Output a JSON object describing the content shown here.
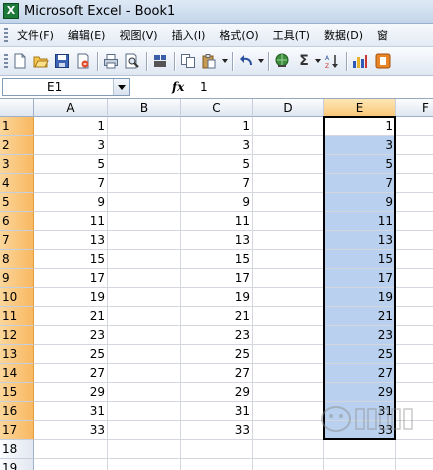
{
  "window": {
    "title": "Microsoft Excel - Book1"
  },
  "menu": [
    "文件(F)",
    "编辑(E)",
    "视图(V)",
    "插入(I)",
    "格式(O)",
    "工具(T)",
    "数据(D)",
    "窗"
  ],
  "toolbar": {
    "icons": [
      "new-icon",
      "open-icon",
      "save-icon",
      "permission-icon",
      "print-icon",
      "print-preview-icon",
      "spelling-icon",
      "copy-icon",
      "paste-icon",
      "undo-icon",
      "hyperlink-icon",
      "autosum-icon",
      "sort-ascending-icon",
      "chart-wizard-icon",
      "help-icon"
    ],
    "autosum_label": "Σ"
  },
  "formula_bar": {
    "name_box": "E1",
    "fx_label": "fx",
    "formula": "1"
  },
  "sheet": {
    "columns": [
      "A",
      "B",
      "C",
      "D",
      "E",
      "F"
    ],
    "selected_column": "E",
    "active_cell": "E1",
    "selection": "E1:E17",
    "rows": [
      {
        "n": "1",
        "A": "1",
        "C": "1",
        "E": "1"
      },
      {
        "n": "2",
        "A": "3",
        "C": "3",
        "E": "3"
      },
      {
        "n": "3",
        "A": "5",
        "C": "5",
        "E": "5"
      },
      {
        "n": "4",
        "A": "7",
        "C": "7",
        "E": "7"
      },
      {
        "n": "5",
        "A": "9",
        "C": "9",
        "E": "9"
      },
      {
        "n": "6",
        "A": "11",
        "C": "11",
        "E": "11"
      },
      {
        "n": "7",
        "A": "13",
        "C": "13",
        "E": "13"
      },
      {
        "n": "8",
        "A": "15",
        "C": "15",
        "E": "15"
      },
      {
        "n": "9",
        "A": "17",
        "C": "17",
        "E": "17"
      },
      {
        "n": "10",
        "A": "19",
        "C": "19",
        "E": "19"
      },
      {
        "n": "11",
        "A": "21",
        "C": "21",
        "E": "21"
      },
      {
        "n": "12",
        "A": "23",
        "C": "23",
        "E": "23"
      },
      {
        "n": "13",
        "A": "25",
        "C": "25",
        "E": "25"
      },
      {
        "n": "14",
        "A": "27",
        "C": "27",
        "E": "27"
      },
      {
        "n": "15",
        "A": "29",
        "C": "29",
        "E": "29"
      },
      {
        "n": "16",
        "A": "31",
        "C": "31",
        "E": "31"
      },
      {
        "n": "17",
        "A": "33",
        "C": "33",
        "E": "33"
      },
      {
        "n": "18"
      },
      {
        "n": "19"
      }
    ]
  },
  "colors": {
    "selection": "#b9d1ee",
    "selected_header": "#f9c77a",
    "grid_line": "#d4d8de"
  }
}
